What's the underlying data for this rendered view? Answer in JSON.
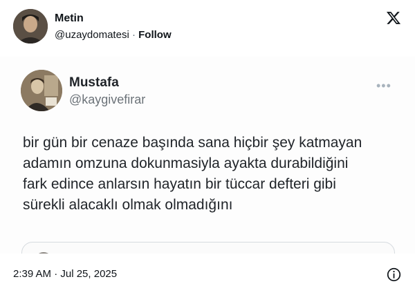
{
  "author": {
    "name": "Metin",
    "handle": "@uzaydomatesi",
    "separator": "·",
    "follow_label": "Follow"
  },
  "quoted_tweet": {
    "name": "Mustafa",
    "handle": "@kaygivefirar",
    "more_label": "•••",
    "text": "bir gün bir cenaze başında sana hiçbir şey katmayan\nadamın omzuna dokunmasiyla ayakta durabildiğini\nfark edince anlarsın hayatın bir tüccar defteri gibi\nsürekli alacaklı olmak olmadığını"
  },
  "footer": {
    "timestamp": "2:39 AM · Jul 25, 2025"
  },
  "icons": {
    "logo": "x-logo-icon",
    "info": "info-icon"
  },
  "colors": {
    "text": "#0f1419",
    "secondary": "#536471",
    "border": "#d6dbdf"
  }
}
